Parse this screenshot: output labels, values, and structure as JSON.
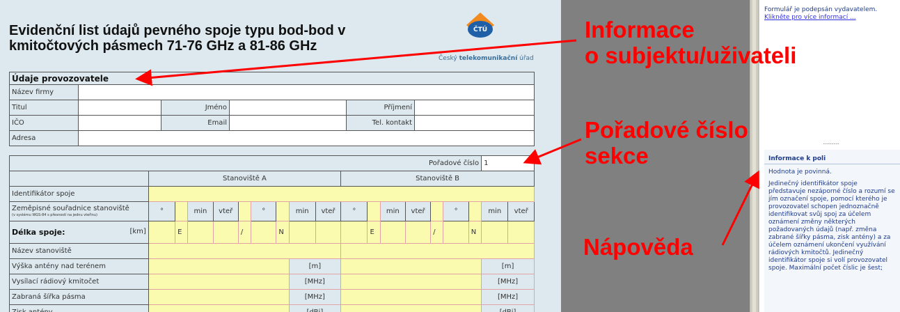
{
  "form": {
    "title_line1": "Evidenční list údajů pevného spoje typu bod-bod v",
    "title_line2": "kmitočtových pásmech 71-76 GHz a 81-86 GHz",
    "logo_text": "ČTÚ",
    "logo_caption_1": "Český ",
    "logo_caption_2": "telekomunikační",
    "logo_caption_3": " úřad",
    "operator_section": "Údaje provozovatele",
    "firm_label": "Název firmy",
    "title_label": "Titul",
    "name_label": "Jméno",
    "surname_label": "Příjmení",
    "ico_label": "IČO",
    "email_label": "Email",
    "tel_label": "Tel. kontakt",
    "address_label": "Adresa",
    "order_label": "Pořadové číslo",
    "order_value": "1",
    "site_a": "Stanoviště A",
    "site_b": "Stanoviště B",
    "link_id_label": "Identifikátor spoje",
    "coords_label": "Zeměpisné souřadnice stanoviště",
    "coords_note": "(v systému WGS-84 s přesností na jednu vteřinu)",
    "deg": "°",
    "min": "min",
    "sec": "vteř",
    "length_label": "Délka spoje:",
    "km": "[km]",
    "east": "E",
    "slash": "/",
    "north": "N",
    "site_name_label": "Název stanoviště",
    "ant_height_label": "Výška antény nad terénem",
    "unit_m": "[m]",
    "tx_freq_label": "Vysílací rádiový kmitočet",
    "unit_mhz": "[MHz]",
    "bandwidth_label": "Zabraná šířka pásma",
    "gain_label": "Zisk antény",
    "unit_dbi": "[dBi]"
  },
  "sidebar": {
    "signed_text": "Formulář je podepsán vydavatelem.",
    "signed_link": "Klikněte pro více informací ...",
    "separator": "........",
    "help_title": "Informace k poli",
    "help_p1": "Hodnota je povinná.",
    "help_p2": "Jedinečný identifikátor spoje představuje nezáporné číslo a rozumí se jím označení spoje, pomocí kterého je provozovatel schopen jednoznačně identifikovat svůj spoj za účelem oznámení změny některých požadovaných údajů (např. změna zabrané šířky pásma, zisk antény) a za účelem oznámení ukončení využívání rádiových kmitočtů. Jedinečný identifikátor spoje si volí provozovatel spoje. Maximální počet číslic je šest;"
  },
  "annotations": {
    "subject_line1": "Informace",
    "subject_line2": "o subjektu/uživateli",
    "order_line1": "Pořadové číslo",
    "order_line2": "sekce",
    "help": "Nápověda"
  },
  "colors": {
    "annotation": "#ff0000",
    "required_field": "#fbfbb0",
    "form_background": "#dde9ee"
  }
}
